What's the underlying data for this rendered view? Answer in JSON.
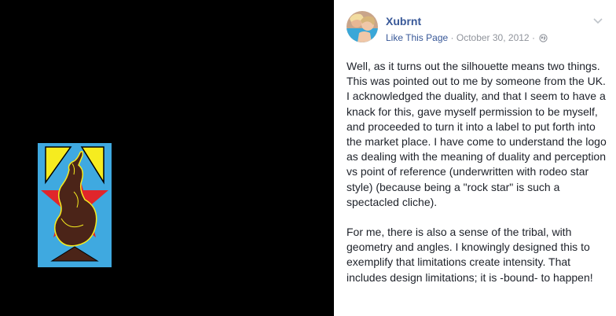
{
  "photo_viewer": {
    "background": "#000000"
  },
  "post": {
    "page_name": "Xubrnt",
    "like_label": "Like This Page",
    "separator": "·",
    "date": "October 30, 2012",
    "separator2": "·",
    "privacy_icon": "globe-icon",
    "menu_icon": "chevron-down-icon",
    "paragraphs": [
      "Well, as it turns out the silhouette means two things. This was pointed out to me by someone from the UK. I acknowledged the duality, and that I seem to have a knack for this, gave myself permission to be myself, and proceeded to turn it into a label to put forth into the market place. I have come to understand the logo as dealing with the meaning of duality and perception vs point of reference (underwritten with rodeo star style) (because being a \"rock star\" is such a spectacled cliche).",
      "For me, there is also a sense of the tribal, with geometry and angles. I knowingly designed this to exemplify that limitations create intensity. That includes design limitations; it is -bound- to happen!"
    ]
  },
  "colors": {
    "link": "#385898",
    "meta": "#90949c",
    "text": "#1d2129",
    "art_background": "#3fa9e0",
    "art_star": "#e0262b",
    "art_triangle": "#f6ec1f",
    "art_figure": "#4b2418"
  }
}
